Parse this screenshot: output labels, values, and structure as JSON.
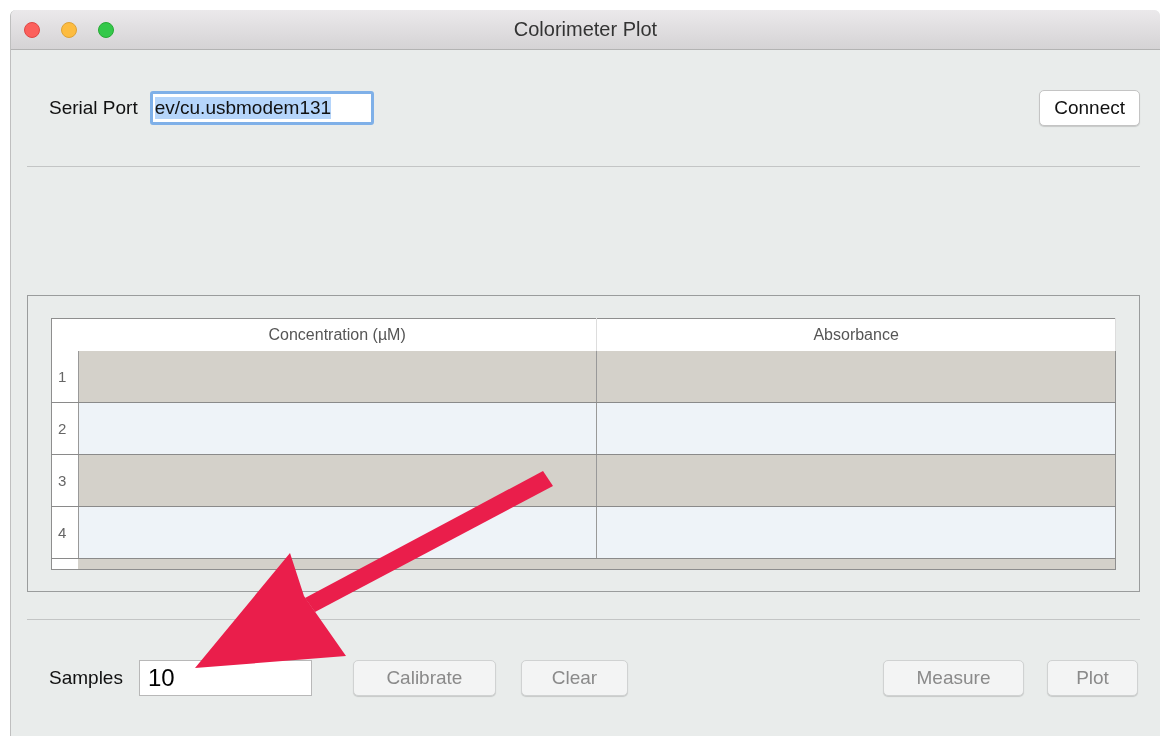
{
  "window": {
    "title": "Colorimeter Plot"
  },
  "serial_port": {
    "label": "Serial Port",
    "value": "ev/cu.usbmodem131",
    "highlighted": true
  },
  "connect_button": {
    "label": "Connect",
    "disabled": false
  },
  "table": {
    "columns": [
      "Concentration (µM)",
      "Absorbance"
    ],
    "rows": [
      {
        "number": "1"
      },
      {
        "number": "2"
      },
      {
        "number": "3"
      },
      {
        "number": "4"
      }
    ]
  },
  "samples": {
    "label": "Samples",
    "value": "10"
  },
  "buttons": [
    {
      "label": "Calibrate",
      "disabled": true
    },
    {
      "label": "Clear",
      "disabled": true
    },
    {
      "label": "Measure",
      "disabled": true
    },
    {
      "label": "Plot",
      "disabled": true
    }
  ]
}
